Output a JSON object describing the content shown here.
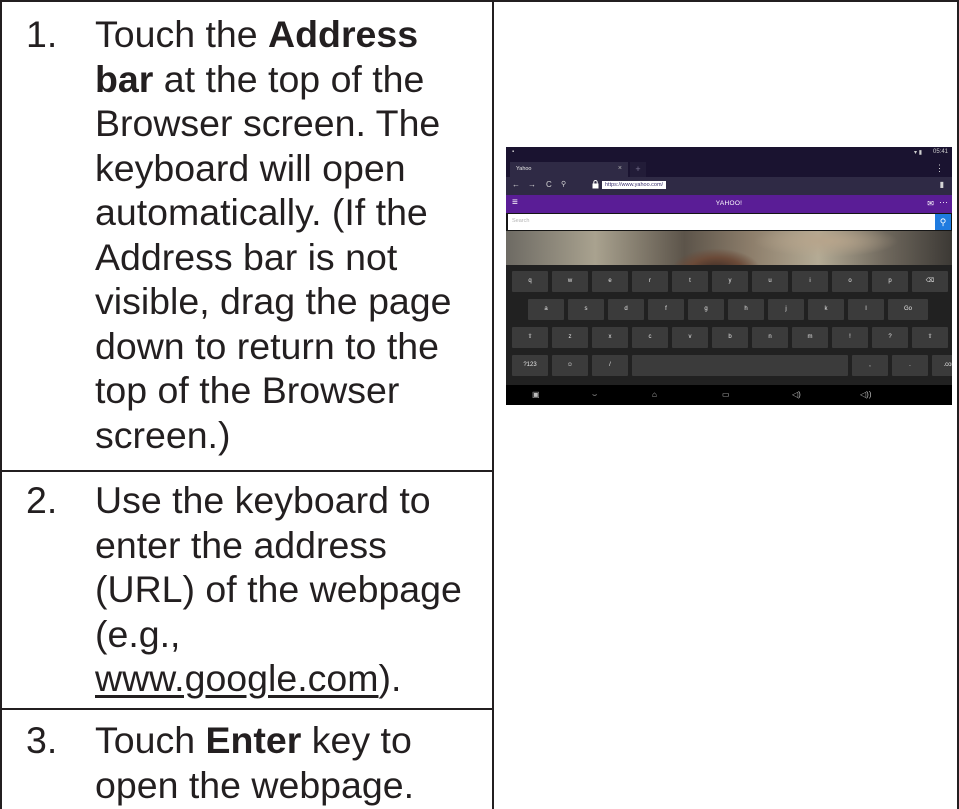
{
  "steps": [
    {
      "number": "1.",
      "segments": [
        {
          "text": "Touch the ",
          "style": "normal"
        },
        {
          "text": "Address bar",
          "style": "bold"
        },
        {
          "text": " at the top of the Browser screen. The keyboard will open automatically. (If the Address bar is not visible, drag the page down to return to the top of the Browser screen.)",
          "style": "normal"
        }
      ]
    },
    {
      "number": "2.",
      "segments": [
        {
          "text": "Use the keyboard to enter the address (URL) of the webpage (e.g., ",
          "style": "normal"
        },
        {
          "text": "www.google.com",
          "style": "underline"
        },
        {
          "text": ").",
          "style": "normal"
        }
      ]
    },
    {
      "number": "3.",
      "segments": [
        {
          "text": "Touch ",
          "style": "normal"
        },
        {
          "text": "Enter",
          "style": "bold"
        },
        {
          "text": " key to open the webpage.",
          "style": "normal"
        }
      ]
    }
  ],
  "screenshot": {
    "status_time": "05:41",
    "tab_title": "Yahoo",
    "url": "https://www.yahoo.com/",
    "site_logo": "YAHOO!",
    "search_placeholder": "Search",
    "keyboard_rows": [
      [
        "q",
        "w",
        "e",
        "r",
        "t",
        "y",
        "u",
        "i",
        "o",
        "p",
        "⌫"
      ],
      [
        "a",
        "s",
        "d",
        "f",
        "g",
        "h",
        "j",
        "k",
        "l",
        "Go"
      ],
      [
        "⇧",
        "z",
        "x",
        "c",
        "v",
        "b",
        "n",
        "m",
        "!",
        "?",
        "⇧"
      ],
      [
        "?123",
        "☺",
        "/",
        "",
        ",",
        ".",
        ".com"
      ]
    ]
  }
}
